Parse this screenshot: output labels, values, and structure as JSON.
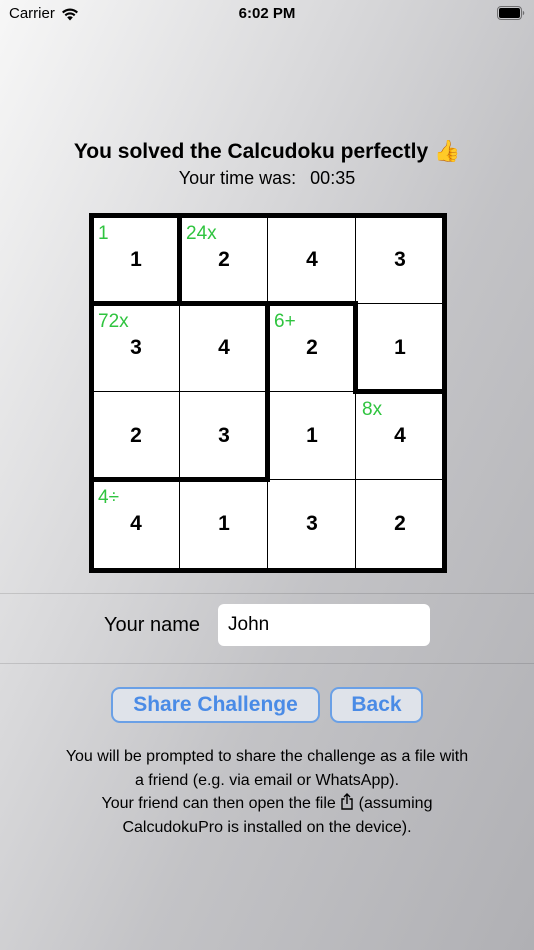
{
  "status_bar": {
    "carrier": "Carrier",
    "time": "6:02 PM"
  },
  "header": {
    "title": "You solved the Calcudoku perfectly 👍",
    "time_label": "Your time was:",
    "time_value": "00:35"
  },
  "grid": {
    "rows": [
      [
        "1",
        "2",
        "4",
        "3"
      ],
      [
        "3",
        "4",
        "2",
        "1"
      ],
      [
        "2",
        "3",
        "1",
        "4"
      ],
      [
        "4",
        "1",
        "3",
        "2"
      ]
    ],
    "clues": [
      {
        "row": 0,
        "col": 0,
        "text": "1"
      },
      {
        "row": 0,
        "col": 1,
        "text": "24x"
      },
      {
        "row": 1,
        "col": 0,
        "text": "72x"
      },
      {
        "row": 1,
        "col": 2,
        "text": "6+"
      },
      {
        "row": 2,
        "col": 3,
        "text": "8x"
      },
      {
        "row": 3,
        "col": 0,
        "text": "4÷"
      }
    ],
    "clue_color": "#2fc43f"
  },
  "name_form": {
    "label": "Your name",
    "value": "John"
  },
  "buttons": {
    "share": "Share Challenge",
    "back": "Back"
  },
  "info": {
    "line1": "You will be prompted to share the challenge as a file with",
    "line2": "a friend (e.g. via email or WhatsApp).",
    "line3a": "Your friend can then open the file",
    "line3b": "(assuming",
    "line4": "CalcudokuPro is installed on the device)."
  },
  "colors": {
    "accent": "#4a8be6",
    "button_border": "#6aa0e6"
  }
}
